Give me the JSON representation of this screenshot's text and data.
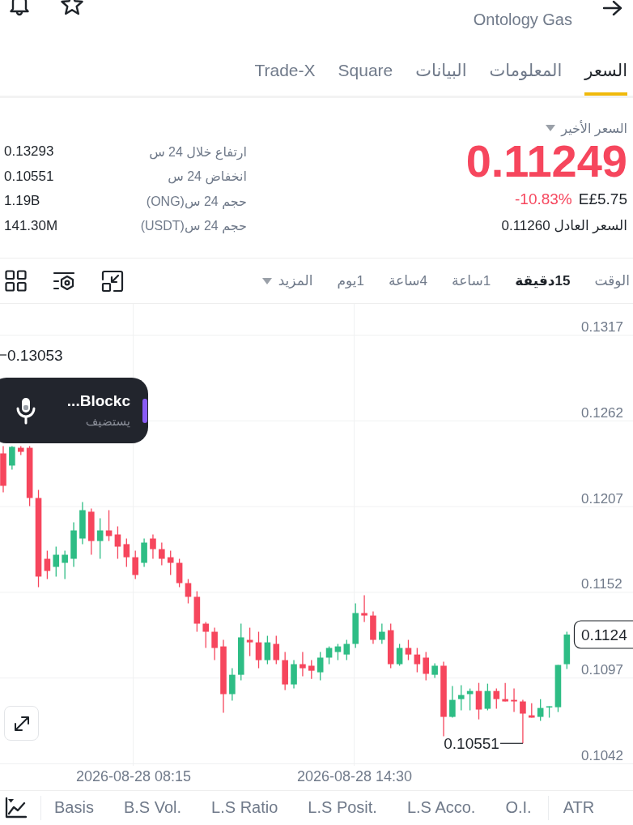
{
  "header": {
    "subtitle": "Ontology Gas"
  },
  "tabs": [
    {
      "label": "السعر",
      "selected": true
    },
    {
      "label": "المعلومات",
      "selected": false
    },
    {
      "label": "البيانات",
      "selected": false
    },
    {
      "label": "Square",
      "selected": false
    },
    {
      "label": "Trade-X",
      "selected": false
    }
  ],
  "price_panel": {
    "last_price_label": "السعر الأخير",
    "negative": true,
    "price": "0.11249",
    "change": "-10.83%",
    "fiat_price": "E£5.75",
    "fair_price": "السعر العادل 0.11260"
  },
  "stats": [
    {
      "label": "ارتفاع خلال 24 س",
      "value": "0.13293"
    },
    {
      "label": "انخفاض 24 س",
      "value": "0.10551"
    },
    {
      "label": "حجم 24 س(ONG)",
      "value": "1.19B"
    },
    {
      "label": "حجم 24 س(USDT)",
      "value": "141.30M"
    }
  ],
  "intervals": [
    {
      "label": "الوقت",
      "selected": false
    },
    {
      "label": "15دقيقة",
      "selected": true
    },
    {
      "label": "1ساعة",
      "selected": false
    },
    {
      "label": "4ساعة",
      "selected": false
    },
    {
      "label": "1يوم",
      "selected": false
    }
  ],
  "more_menu": {
    "label": "المزيد"
  },
  "chart": {
    "chart_data": {
      "type": "candlestick",
      "ohlc": [
        [
          0.12411,
          0.12458,
          0.12161,
          0.12203
        ],
        [
          0.12333,
          0.12458,
          0.12307,
          0.12453
        ],
        [
          0.12447,
          0.12458,
          0.12401,
          0.12421
        ],
        [
          0.12447,
          0.12458,
          0.12073,
          0.12125
        ],
        [
          0.12125,
          0.12177,
          0.11553,
          0.11621
        ],
        [
          0.11735,
          0.11787,
          0.11605,
          0.11657
        ],
        [
          0.11683,
          0.11813,
          0.11621,
          0.11761
        ],
        [
          0.11709,
          0.11787,
          0.11605,
          0.11761
        ],
        [
          0.11735,
          0.11969,
          0.11683,
          0.11917
        ],
        [
          0.11865,
          0.12099,
          0.11829,
          0.12047
        ],
        [
          0.12037,
          0.12057,
          0.11761,
          0.11849
        ],
        [
          0.11849,
          0.11995,
          0.11735,
          0.11917
        ],
        [
          0.11917,
          0.12047,
          0.11849,
          0.11881
        ],
        [
          0.11891,
          0.11943,
          0.11735,
          0.11813
        ],
        [
          0.11829,
          0.11865,
          0.11683,
          0.11745
        ],
        [
          0.11745,
          0.11787,
          0.11605,
          0.11631
        ],
        [
          0.11709,
          0.11865,
          0.11683,
          0.11839
        ],
        [
          0.11865,
          0.11891,
          0.11735,
          0.11797
        ],
        [
          0.11797,
          0.11839,
          0.11693,
          0.11735
        ],
        [
          0.11745,
          0.11787,
          0.11631,
          0.11709
        ],
        [
          0.11709,
          0.11735,
          0.11553,
          0.11579
        ],
        [
          0.11579,
          0.11605,
          0.11449,
          0.11491
        ],
        [
          0.11491,
          0.11527,
          0.11267,
          0.11319
        ],
        [
          0.11319,
          0.11329,
          0.11163,
          0.11267
        ],
        [
          0.11267,
          0.11293,
          0.11085,
          0.11163
        ],
        [
          0.11173,
          0.11215,
          0.10747,
          0.10867
        ],
        [
          0.10867,
          0.11033,
          0.10825,
          0.10991
        ],
        [
          0.10991,
          0.11319,
          0.10955,
          0.11231
        ],
        [
          0.11215,
          0.11293,
          0.11111,
          0.11199
        ],
        [
          0.11199,
          0.11267,
          0.11033,
          0.11085
        ],
        [
          0.11085,
          0.11241,
          0.11059,
          0.11199
        ],
        [
          0.11189,
          0.11241,
          0.11059,
          0.11085
        ],
        [
          0.11085,
          0.11137,
          0.10893,
          0.10929
        ],
        [
          0.10929,
          0.11085,
          0.10903,
          0.11059
        ],
        [
          0.11059,
          0.11137,
          0.10981,
          0.11033
        ],
        [
          0.11049,
          0.11085,
          0.10965,
          0.11017
        ],
        [
          0.11007,
          0.11137,
          0.10955,
          0.11101
        ],
        [
          0.11101,
          0.11173,
          0.11059,
          0.11163
        ],
        [
          0.11137,
          0.11189,
          0.11085,
          0.11173
        ],
        [
          0.11121,
          0.11215,
          0.11085,
          0.11189
        ],
        [
          0.11189,
          0.11449,
          0.11163,
          0.11387
        ],
        [
          0.11387,
          0.11501,
          0.11329,
          0.11371
        ],
        [
          0.11371,
          0.11397,
          0.11189,
          0.11215
        ],
        [
          0.11215,
          0.11319,
          0.11189,
          0.11267
        ],
        [
          0.11277,
          0.11319,
          0.11033,
          0.11059
        ],
        [
          0.11059,
          0.11189,
          0.11049,
          0.11163
        ],
        [
          0.11163,
          0.11215,
          0.11085,
          0.11121
        ],
        [
          0.11121,
          0.11163,
          0.11007,
          0.11059
        ],
        [
          0.11101,
          0.11137,
          0.10955,
          0.10997
        ],
        [
          0.10991,
          0.11064,
          0.10971,
          0.11049
        ],
        [
          0.11049,
          0.11075,
          0.10596,
          0.10721
        ],
        [
          0.10721,
          0.10919,
          0.10716,
          0.1083
        ],
        [
          0.10835,
          0.10924,
          0.10763,
          0.10861
        ],
        [
          0.10867,
          0.10903,
          0.10763,
          0.10887
        ],
        [
          0.10887,
          0.10939,
          0.10705,
          0.10768
        ],
        [
          0.10773,
          0.10934,
          0.10763,
          0.10887
        ],
        [
          0.10887,
          0.10903,
          0.10773,
          0.10835
        ],
        [
          0.10835,
          0.10939,
          0.1082,
          0.1082
        ],
        [
          0.1083,
          0.10903,
          0.10752,
          0.1082
        ],
        [
          0.1082,
          0.1083,
          0.10551,
          0.10742
        ],
        [
          0.10731,
          0.10809,
          0.10716,
          0.10716
        ],
        [
          0.10721,
          0.10835,
          0.10695,
          0.10778
        ],
        [
          0.10783,
          0.10789,
          0.10716,
          0.10789
        ],
        [
          0.10783,
          0.11054,
          0.10752,
          0.11054
        ],
        [
          0.11059,
          0.11267,
          0.11028,
          0.11249
        ]
      ],
      "ylim": [
        0.1041,
        0.1337
      ],
      "yticks": [
        0.1317,
        0.1262,
        0.1207,
        0.1152,
        0.1097,
        0.1042
      ],
      "grid": true
    },
    "high_label": "0.13053",
    "low_label": "0.10551",
    "current_price_tag": "0.1124",
    "time_axis": [
      "2026-08-28 14:30",
      "2026-08-28 08:15"
    ]
  },
  "live_audio": {
    "title": "...Blockc",
    "subtitle": "يستضيف"
  },
  "indicator_tabs": [
    "ATR"
  ],
  "data_tabs": [
    "O.I.",
    "L.S Acco.",
    "L.S Posit.",
    "L.S Ratio",
    "B.S Vol.",
    "Basis"
  ]
}
